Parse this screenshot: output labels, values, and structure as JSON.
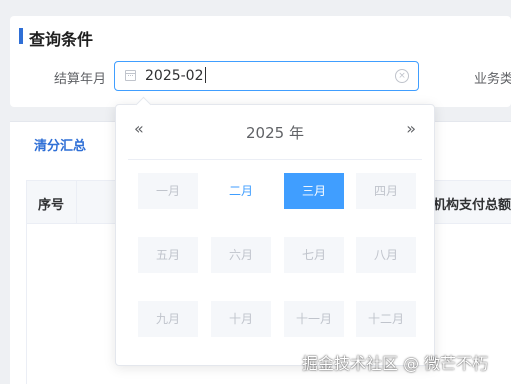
{
  "query": {
    "title": "查询条件",
    "month_label": "结算年月",
    "month_value": "2025-02",
    "clear_glyph": "×",
    "business_label": "业务类"
  },
  "summary": {
    "tab_label": "清分汇总",
    "columns": [
      "序号",
      "机构支付总额"
    ]
  },
  "picker": {
    "prev_glyph": "«",
    "next_glyph": "»",
    "year_label": "2025 年",
    "months": [
      {
        "label": "一月",
        "state": "disabled"
      },
      {
        "label": "二月",
        "state": "enabled"
      },
      {
        "label": "三月",
        "state": "current"
      },
      {
        "label": "四月",
        "state": "disabled"
      },
      {
        "label": "五月",
        "state": "disabled"
      },
      {
        "label": "六月",
        "state": "disabled"
      },
      {
        "label": "七月",
        "state": "disabled"
      },
      {
        "label": "八月",
        "state": "disabled"
      },
      {
        "label": "九月",
        "state": "disabled"
      },
      {
        "label": "十月",
        "state": "disabled"
      },
      {
        "label": "十一月",
        "state": "disabled"
      },
      {
        "label": "十二月",
        "state": "disabled"
      }
    ]
  },
  "watermark": "掘金技术社区 @ 微芒不朽",
  "colors": {
    "accent": "#409eff",
    "title_bar": "#2f6fd6",
    "disabled_text": "#c0c4cc",
    "disabled_bg": "#f5f7fa"
  }
}
